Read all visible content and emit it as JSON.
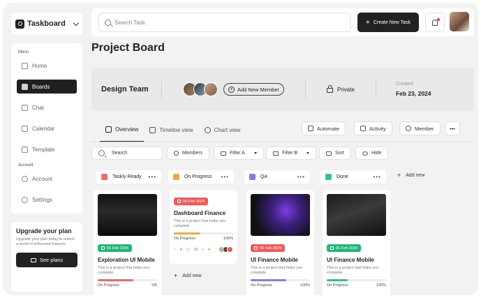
{
  "app": {
    "name": "Taskboard"
  },
  "sidebar": {
    "menu_label": "Menu",
    "items": [
      {
        "label": "Home",
        "icon": "home-icon",
        "active": false
      },
      {
        "label": "Boards",
        "icon": "boards-icon",
        "active": true
      },
      {
        "label": "Chat",
        "icon": "chat-icon",
        "active": false
      },
      {
        "label": "Calendar",
        "icon": "calendar-icon",
        "active": false
      },
      {
        "label": "Template",
        "icon": "template-icon",
        "active": false
      }
    ],
    "account_label": "Account",
    "account_items": [
      {
        "label": "Account",
        "icon": "user-icon"
      },
      {
        "label": "Settings",
        "icon": "gear-icon"
      }
    ],
    "upgrade": {
      "title": "Upgrade your plan",
      "desc": "Upgrade your plan today to unlock a world of enhanced features",
      "button": "See plans"
    }
  },
  "topbar": {
    "search_placeholder": "Search Task",
    "create_button": "Create New Task"
  },
  "page": {
    "title": "Project Board"
  },
  "team": {
    "name": "Design Team",
    "add_member": "Add New Member",
    "privacy": "Private",
    "created_label": "Created",
    "created_date": "Feb 23, 2024"
  },
  "tabs": [
    {
      "label": "Overview",
      "icon": "grid-icon",
      "active": true
    },
    {
      "label": "Timeline view",
      "icon": "timeline-icon",
      "active": false
    },
    {
      "label": "Chart view",
      "icon": "chart-icon",
      "active": false
    }
  ],
  "actions": {
    "automate": "Automate",
    "activity": "Activity",
    "member": "Member",
    "more": "•••"
  },
  "filters": {
    "search": "Search",
    "members": "Members",
    "filter_a": "Filter A",
    "filter_b": "Filter B",
    "sort": "Sort",
    "hide": "Hide"
  },
  "columns": [
    {
      "title": "Taskly Ready",
      "color": "#f06b6b"
    },
    {
      "title": "On Progress",
      "color": "#f5a93c"
    },
    {
      "title": "QA",
      "color": "#8b79e8"
    },
    {
      "title": "Done",
      "color": "#2fc38a"
    }
  ],
  "add_new": "Add new",
  "add_new_col": "Add new",
  "cards": [
    {
      "date": "06 Feb 2024",
      "badge_color": "#1fb877",
      "title": "Exploration UI Mobile",
      "desc": "This is a project that helps you complete",
      "status": "On Progress",
      "progress_value": "0/6",
      "progress": 0.6,
      "bar_color": "#f06b6b"
    },
    {
      "date": "06 Feb 2024",
      "badge_color": "#f05a5a",
      "title": "Dashboard Finance",
      "desc": "This is a project that helps you complete",
      "status": "On Progress",
      "progress_value": "100%",
      "progress": 0.45,
      "bar_color": "#f5a93c",
      "counts": [
        "4",
        "15",
        "4"
      ]
    },
    {
      "date": "06 Feb 2024",
      "badge_color": "#f05a5a",
      "title": "UI Finance Mobile",
      "desc": "This is a project that helps you complete",
      "status": "On Progress",
      "progress_value": "100%",
      "progress": 0.6,
      "bar_color": "#8b79e8"
    },
    {
      "date": "06 Feb 2024",
      "badge_color": "#1fb877",
      "title": "UI Finance Mobile",
      "desc": "This is a project that helps you complete",
      "status": "On Progress",
      "progress_value": "100%",
      "progress": 0.35,
      "bar_color": "#2fc38a"
    }
  ]
}
